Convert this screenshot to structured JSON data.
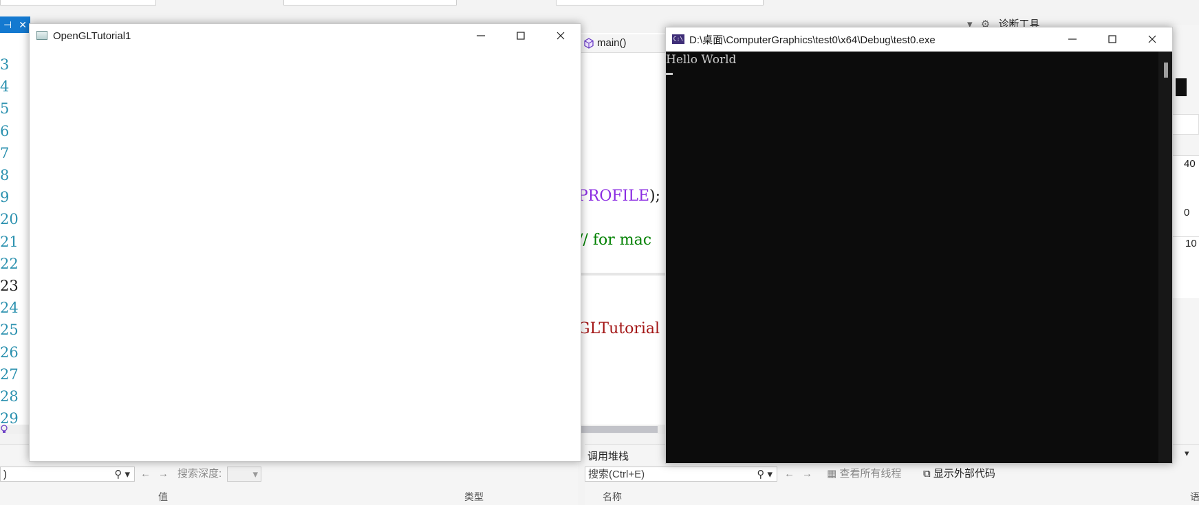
{
  "ide": {
    "line_numbers": [
      "3",
      "4",
      "5",
      "6",
      "7",
      "8",
      "9",
      "20",
      "21",
      "22",
      "23",
      "24",
      "25",
      "26",
      "27",
      "28",
      "29"
    ],
    "nav_function": "main()",
    "code_fragments": {
      "profile": "PROFILE",
      "profile_tail": ");",
      "comment": "// for mac",
      "tutorial": "GLTutorial"
    },
    "diag_title": "诊断工具",
    "right_numbers": [
      "40",
      "0",
      "10"
    ],
    "pin_label": "⊣",
    "close_glyph": "✕",
    "locals": {
      "search_value": ")",
      "search_depth_label": "搜索深度:",
      "col_value": "值",
      "col_type": "类型"
    },
    "callstack": {
      "title": "调用堆栈",
      "search_placeholder": "搜索(Ctrl+E)",
      "view_all_threads": "查看所有线程",
      "show_external_code": "显示外部代码",
      "col_name": "名称",
      "col_lang": "语"
    }
  },
  "gl_window": {
    "title": "OpenGLTutorial1"
  },
  "console_window": {
    "title": "D:\\桌面\\ComputerGraphics\\test0\\x64\\Debug\\test0.exe",
    "icon_label": "C:\\",
    "output": "Hello World"
  },
  "colors": {
    "accent": "#1479d0",
    "console_bg": "#0c0c0c",
    "console_text": "#cccccc",
    "macro": "#8a2be2",
    "comment": "#008000",
    "string": "#a31515"
  }
}
